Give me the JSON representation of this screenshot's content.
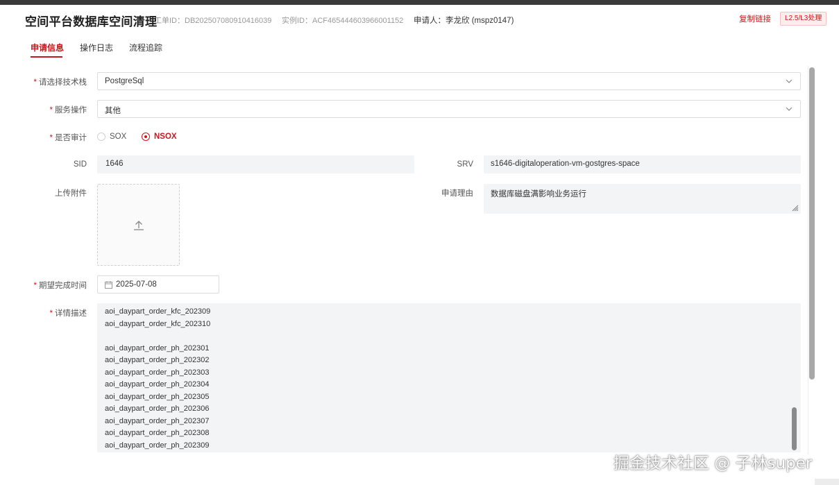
{
  "header": {
    "title": "空间平台数据库空间清理",
    "ticket_id": "工单ID：DB202507080910416039",
    "instance_id": "实例ID：ACF465444603966001152",
    "applicant": "申请人：李龙欣 (mspz0147)",
    "copy_link_label": "复制链接",
    "level_badge": "L2.5/L3处理"
  },
  "tabs": [
    {
      "label": "申请信息",
      "active": true
    },
    {
      "label": "操作日志",
      "active": false
    },
    {
      "label": "流程追踪",
      "active": false
    }
  ],
  "form": {
    "tech_stack": {
      "label": "请选择技术栈",
      "required": true,
      "value": "PostgreSql"
    },
    "service_operation": {
      "label": "服务操作",
      "required": true,
      "value": "其他"
    },
    "audit": {
      "label": "是否审计",
      "required": true,
      "options": [
        {
          "label": "SOX",
          "checked": false
        },
        {
          "label": "NSOX",
          "checked": true
        }
      ]
    },
    "sid": {
      "label": "SID",
      "value": "1646"
    },
    "srv": {
      "label": "SRV",
      "value": "s1646-digitaloperation-vm-gostgres-space"
    },
    "attachment": {
      "label": "上传附件"
    },
    "reason": {
      "label": "申请理由",
      "value": "数据库磁盘满影响业务运行"
    },
    "due_date": {
      "label": "期望完成时间",
      "required": true,
      "value": "2025-07-08"
    },
    "detail": {
      "label": "详情描述",
      "required": true,
      "lines": [
        "aoi_daypart_order_kfc_202309",
        "aoi_daypart_order_kfc_202310",
        "",
        "aoi_daypart_order_ph_202301",
        "aoi_daypart_order_ph_202302",
        "aoi_daypart_order_ph_202303",
        "aoi_daypart_order_ph_202304",
        "aoi_daypart_order_ph_202305",
        "aoi_daypart_order_ph_202306",
        "aoi_daypart_order_ph_202307",
        "aoi_daypart_order_ph_202308",
        "aoi_daypart_order_ph_202309"
      ]
    }
  },
  "watermark": "掘金技术社区 @ 子林super",
  "colors": {
    "accent": "#c8161d",
    "readonly_bg": "#f3f4f5",
    "topbar": "#3a3a3a"
  }
}
